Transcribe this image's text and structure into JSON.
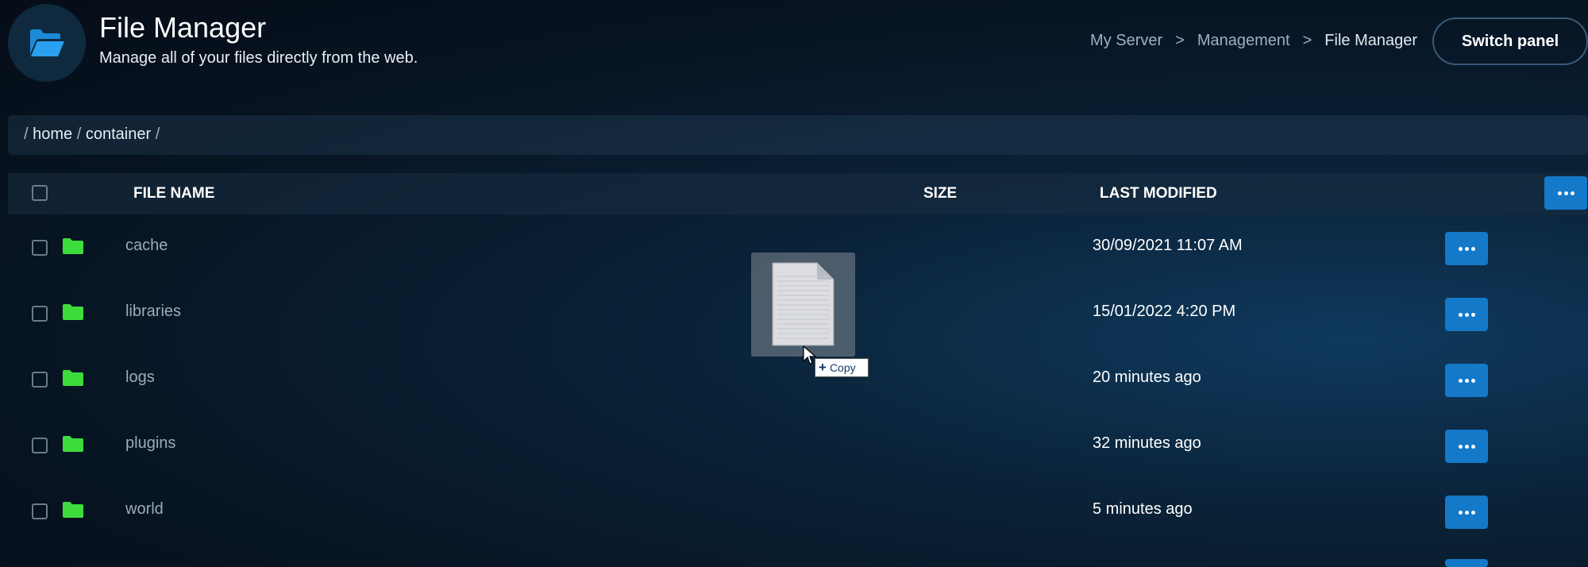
{
  "header": {
    "title": "File Manager",
    "subtitle": "Manage all of your files directly from the web.",
    "icon": "folder-open-icon"
  },
  "breadcrumb": {
    "items": [
      "My Server",
      "Management",
      "File Manager"
    ],
    "separator": ">"
  },
  "switch_panel_label": "Switch panel",
  "path": {
    "root": "/",
    "segments": [
      "home",
      "container"
    ],
    "separator": "/"
  },
  "table": {
    "columns": {
      "name": "FILE NAME",
      "size": "SIZE",
      "modified": "LAST MODIFIED"
    },
    "rows": [
      {
        "name": "cache",
        "size": "",
        "modified": "30/09/2021 11:07 AM"
      },
      {
        "name": "libraries",
        "size": "",
        "modified": "15/01/2022 4:20 PM"
      },
      {
        "name": "logs",
        "size": "",
        "modified": "20 minutes ago"
      },
      {
        "name": "plugins",
        "size": "",
        "modified": "32 minutes ago"
      },
      {
        "name": "world",
        "size": "",
        "modified": "5 minutes ago"
      }
    ]
  },
  "drag": {
    "tooltip": "Copy",
    "icon": "document-icon"
  },
  "colors": {
    "accent": "#1479c9",
    "folder": "#3ddc3d",
    "background": "#071422"
  }
}
